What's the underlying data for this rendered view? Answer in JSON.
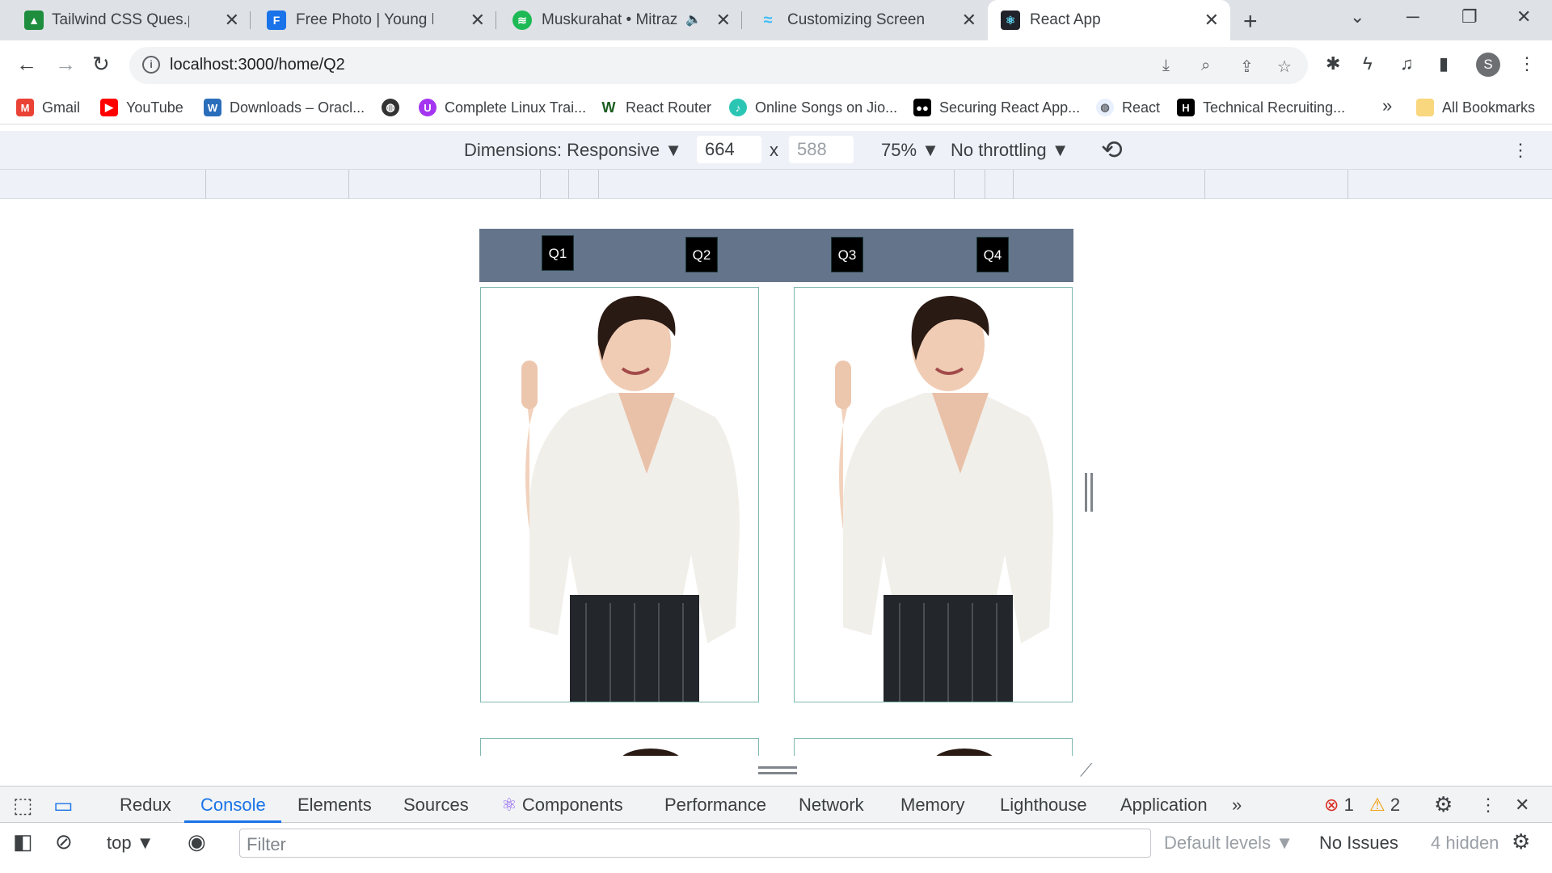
{
  "tabs": [
    {
      "title": "Tailwind CSS Ques.pdf - G",
      "icon": "google-drive-icon",
      "color": "#1e8e3e"
    },
    {
      "title": "Free Photo | Young happy",
      "icon": "freepik-icon",
      "color": "#1a73e8"
    },
    {
      "title": "Muskurahat • Mitraz",
      "icon": "spotify-icon",
      "color": "#1db954"
    },
    {
      "title": "Customizing Screens - Tai",
      "icon": "tailwind-icon",
      "color": "#38bdf8"
    },
    {
      "title": "React App",
      "icon": "react-icon",
      "color": "#149eca"
    }
  ],
  "address": {
    "url": "localhost:3000/home/Q2"
  },
  "bookmarks": [
    {
      "label": "Gmail",
      "icon": "gmail-icon",
      "color": "#ea4335"
    },
    {
      "label": "YouTube",
      "icon": "youtube-icon",
      "color": "#ff0000"
    },
    {
      "label": "Downloads – Oracl...",
      "icon": "oracle-icon",
      "color": "#2a6ebb"
    },
    {
      "label": "",
      "icon": "globe-icon",
      "color": "#333333"
    },
    {
      "label": "Complete Linux Trai...",
      "icon": "udemy-icon",
      "color": "#a435f0"
    },
    {
      "label": "React Router",
      "icon": "react-router-icon",
      "color": "#1b5e20"
    },
    {
      "label": "Online Songs on Jio...",
      "icon": "jiosaavn-icon",
      "color": "#2bc5b4"
    },
    {
      "label": "Securing React App...",
      "icon": "medium-icon",
      "color": "#000000"
    },
    {
      "label": "React",
      "icon": "globe-icon",
      "color": "#5f6368"
    },
    {
      "label": "Technical Recruiting...",
      "icon": "hackerrank-icon",
      "color": "#000000"
    }
  ],
  "bookmarks_more": "»",
  "all_bookmarks": "All Bookmarks",
  "device_toolbar": {
    "dimensions": "Dimensions: Responsive",
    "width": "664",
    "x": "x",
    "height": "588",
    "zoom": "75%",
    "throttling": "No throttling"
  },
  "app": {
    "nav": [
      "Q1",
      "Q2",
      "Q3",
      "Q4"
    ],
    "accent": "#64748b",
    "card_border": "#7fb8b0"
  },
  "devtools": {
    "tabs": [
      "Redux",
      "Console",
      "Elements",
      "Sources",
      "Components",
      "Performance",
      "Network",
      "Memory",
      "Lighthouse",
      "Application"
    ],
    "active_tab": "Console",
    "more": "»",
    "errors": "1",
    "warnings": "2",
    "context": "top",
    "filter_placeholder": "Filter",
    "levels": "Default levels",
    "issues": "No Issues",
    "hidden": "4 hidden"
  },
  "avatar_letter": "S"
}
